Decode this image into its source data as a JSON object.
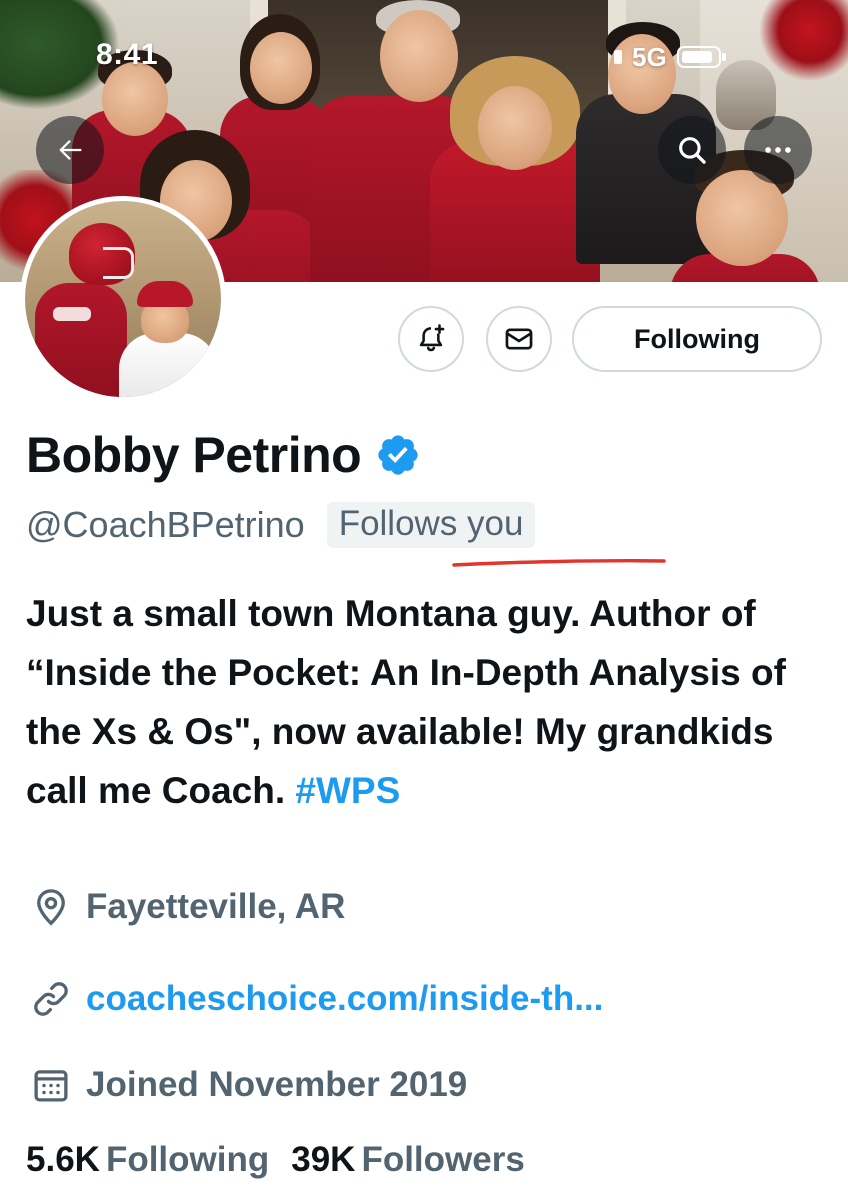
{
  "status_bar": {
    "time": "8:41",
    "network": "5G"
  },
  "header": {
    "back_icon": "arrow-left-icon",
    "search_icon": "search-icon",
    "more_icon": "more-dots-icon"
  },
  "actions": {
    "notify_icon": "bell-plus-icon",
    "message_icon": "envelope-icon",
    "following_label": "Following"
  },
  "profile": {
    "name": "Bobby Petrino",
    "verified_icon": "verified-badge-icon",
    "verified_color": "#1d9bf0",
    "handle": "@CoachBPetrino",
    "follows_you": "Follows you",
    "bio_text": "Just a small town Montana guy. Author of “Inside the Pocket: An In-Depth Analysis of the Xs & Os\", now available! My grandkids call me Coach.",
    "bio_hashtag": "#WPS",
    "location": "Fayetteville, AR",
    "location_icon": "location-pin-icon",
    "website": "coacheschoice.com/inside-th...",
    "website_icon": "link-icon",
    "joined": "Joined November 2019",
    "joined_icon": "calendar-icon"
  },
  "stats": {
    "following_count": "5.6K",
    "following_label": "Following",
    "followers_count": "39K",
    "followers_label": "Followers"
  },
  "annotation": {
    "underline_color": "#e0362c"
  }
}
